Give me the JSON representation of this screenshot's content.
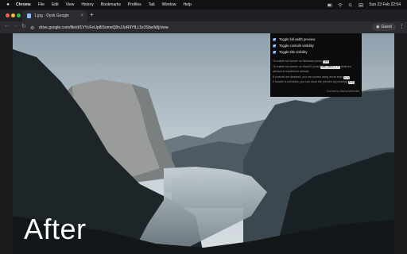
{
  "menubar": {
    "app": "Chrome",
    "items": [
      "File",
      "Edit",
      "View",
      "History",
      "Bookmarks",
      "Profiles",
      "Tab",
      "Window",
      "Help"
    ],
    "clock": "Sun 23 Feb 22:54"
  },
  "tab": {
    "title": "1.jpg - Dysk Google",
    "close": "×"
  },
  "toolbar": {
    "url": "drive.google.com/file/d/1VYcFeUp8iSomeQ8nJJoR9YfLL5z3Sbe/k8j/view",
    "profile": "Guest"
  },
  "panel": {
    "options": [
      {
        "label": "Toggle full width preview",
        "checked": true
      },
      {
        "label": "Toggle controls visibility",
        "checked": true
      },
      {
        "label": "Toggle title visibility",
        "checked": true
      }
    ],
    "info": [
      {
        "pre": "To enable full screen on Windows press ",
        "key": "F11",
        "post": ""
      },
      {
        "pre": "To enable full screen on MacOS press ",
        "key": "CMD SHIFT F",
        "post": " while the"
      },
      {
        "pre": "window is maximized already",
        "key": "",
        "post": ""
      },
      {
        "pre": "If controls are disabled, you can control using arrow keys ",
        "key": "← →",
        "post": ""
      },
      {
        "pre": "If header is unhidden, you can close the preview by pressing ",
        "key": "ESC",
        "post": ""
      }
    ],
    "credit": "Licence by Michał Weinrath"
  },
  "image": {
    "caption": "After"
  },
  "colors": {
    "checkbox": "#3b78d8",
    "panel_bg": "#0b0b0b"
  }
}
